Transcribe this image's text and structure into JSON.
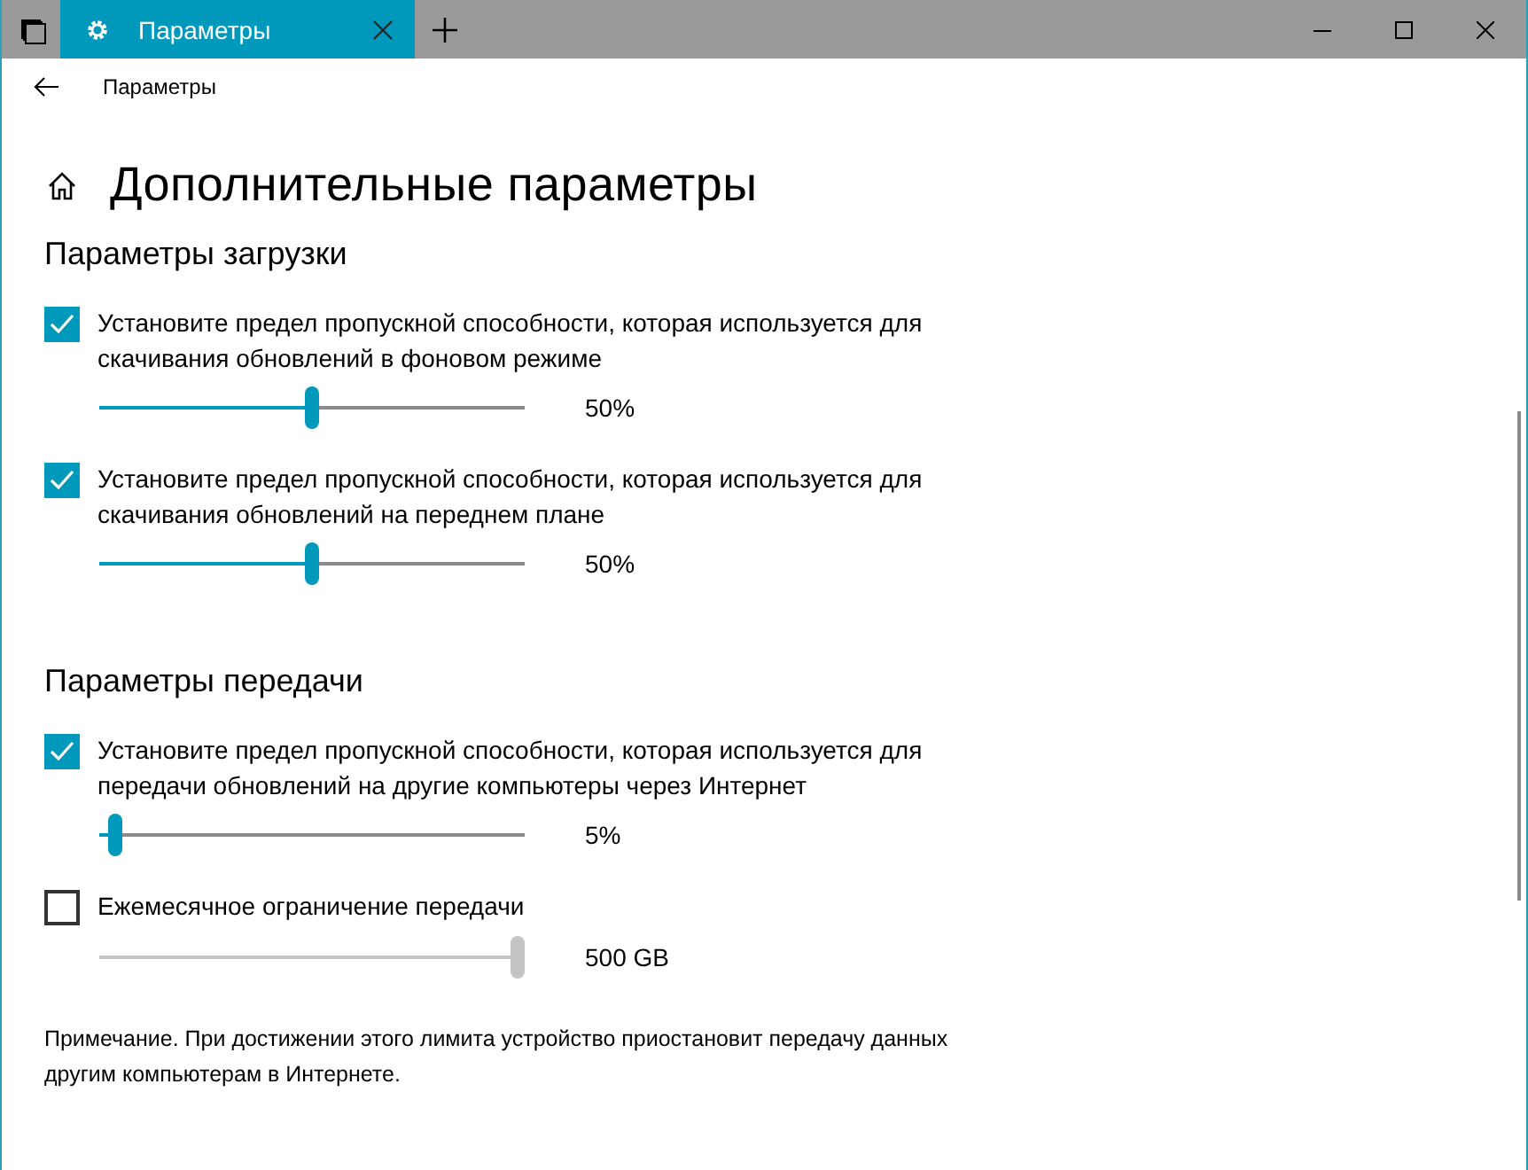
{
  "window": {
    "tab_title": "Параметры"
  },
  "nav": {
    "title": "Параметры"
  },
  "page": {
    "title": "Дополнительные параметры"
  },
  "sections": [
    {
      "heading": "Параметры загрузки",
      "options": [
        {
          "label": "Установите предел пропускной способности, которая используется для скачивания обновлений в фоновом режиме",
          "checked": true,
          "slider": {
            "level": 0.5,
            "reading": "50%",
            "disabled": false
          }
        },
        {
          "label": "Установите предел пропускной способности, которая используется для скачивания обновлений на переднем плане",
          "checked": true,
          "slider": {
            "level": 0.5,
            "reading": "50%",
            "disabled": false
          }
        }
      ]
    },
    {
      "heading": "Параметры передачи",
      "options": [
        {
          "label": "Установите предел пропускной способности, которая используется для передачи обновлений на другие компьютеры через Интернет",
          "checked": true,
          "slider": {
            "level": 0.02,
            "reading": "5%",
            "disabled": false
          }
        },
        {
          "label": "Ежемесячное ограничение передачи",
          "checked": false,
          "slider": {
            "level": 1,
            "reading": "500 GB",
            "disabled": true
          }
        }
      ]
    }
  ],
  "note": "Примечание. При достижении этого лимита устройство приостановит передачу данных другим компьютерам в Интернете."
}
